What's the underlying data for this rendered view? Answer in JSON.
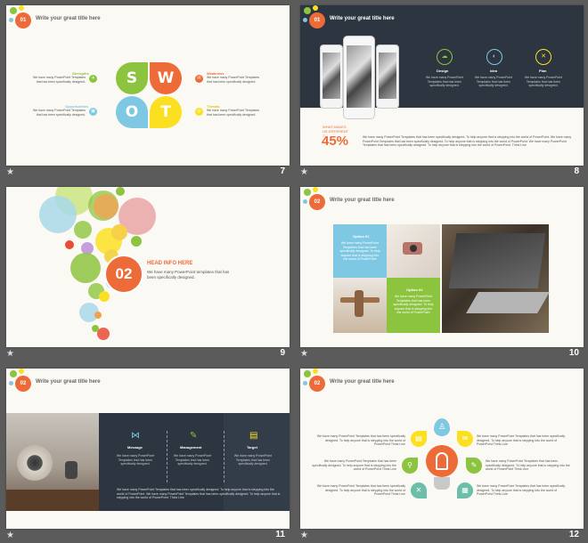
{
  "slides": [
    {
      "number": "7",
      "badge": "01",
      "title": "Write your great title here",
      "swot": [
        "S",
        "W",
        "O",
        "T"
      ],
      "items": [
        {
          "label": "Strengths",
          "text": "We have many PowerPoint Templates that has been specifically designed."
        },
        {
          "label": "Opportunities",
          "text": "We have many PowerPoint Templates that has been specifically designed."
        },
        {
          "label": "Weakness",
          "text": "We have many PowerPoint Templates that has been specifically designed."
        },
        {
          "label": "Threats",
          "text": "We have many PowerPoint Templates that has been specifically designed."
        }
      ]
    },
    {
      "number": "8",
      "badge": "01",
      "title": "Write your great title here",
      "columns": [
        {
          "label": "Design",
          "text": "We have many PowerPoint Templates that has been specifically designed."
        },
        {
          "label": "Idea",
          "text": "We have many PowerPoint Templates that has been specifically designed."
        },
        {
          "label": "Plan",
          "text": "We have many PowerPoint Templates that has been specifically designed."
        }
      ],
      "question": "WHAT MAKES US DIFFERENT ?",
      "percent": "45%",
      "paragraph": "We have many PowerPoint Templates that has been specifically designed. To help anyone that is stepping into the world of PowerPoint. We have many PowerPoint Templates that has been specifically designed. To help anyone that is stepping into the world of PowerPoint. We have many PowerPoint Templates that has been specifically designed. To help anyone that is stepping into the world of PowerPoint. Think Line"
    },
    {
      "number": "9",
      "badge": "02",
      "title": "HEAD INFO HERE",
      "text": "We have many PowerPoint templates that has been specifically designed."
    },
    {
      "number": "10",
      "badge": "02",
      "title": "Write your great title here",
      "boxes": [
        {
          "label": "Option 01",
          "text": "We have many PowerPoint Templates that has been specifically designed. To help anyone that is stepping into the world of PowerPoint"
        },
        {
          "label": "Option 02",
          "text": "We have many PowerPoint Templates that has been specifically designed. To help anyone that is stepping into the world of PowerPoint"
        }
      ]
    },
    {
      "number": "11",
      "badge": "02",
      "title": "Write your great title here",
      "columns": [
        {
          "label": "Message",
          "text": "We have many PowerPoint Templates that has been specifically designed."
        },
        {
          "label": "Management",
          "text": "We have many PowerPoint Templates that has been specifically designed."
        },
        {
          "label": "Target",
          "text": "We have many PowerPoint Templates that has been specifically designed."
        }
      ],
      "paragraph": "We have many PowerPoint Templates that has been specifically designed. To help anyone that is stepping into the world of PowerPoint. We have many PowerPoint Templates that has been specifically designed. To help anyone that is stepping into the world of PowerPoint. Think Line"
    },
    {
      "number": "12",
      "badge": "02",
      "title": "Write your great title here",
      "left_texts": [
        "We have many PowerPoint Templates that has been specifically designed. To help anyone that is stepping into the world of PowerPoint Think Line",
        "We have many PowerPoint Templates that has been specifically designed. To help anyone that is stepping into the world of PowerPoint Think Line",
        "We have many PowerPoint Templates that has been specifically designed. To help anyone that is stepping into the world of PowerPoint Think Line"
      ],
      "right_texts": [
        "We have many PowerPoint Templates that has been specifically designed. To help anyone that is stepping into the world of PowerPoint Think Line",
        "We have many PowerPoint Templates that has been specifically designed. To help anyone that is stepping into the world of PowerPoint Think Line",
        "We have many PowerPoint Templates that has been specifically designed. To help anyone that is stepping into the world of PowerPoint Think Line"
      ]
    }
  ],
  "colors": {
    "orange": "#ed6b39",
    "green": "#8dc43f",
    "blue": "#7ec8e3",
    "yellow": "#fbe022",
    "dark": "#2c3540",
    "red": "#e94b35"
  },
  "icons": {
    "star": "★"
  }
}
